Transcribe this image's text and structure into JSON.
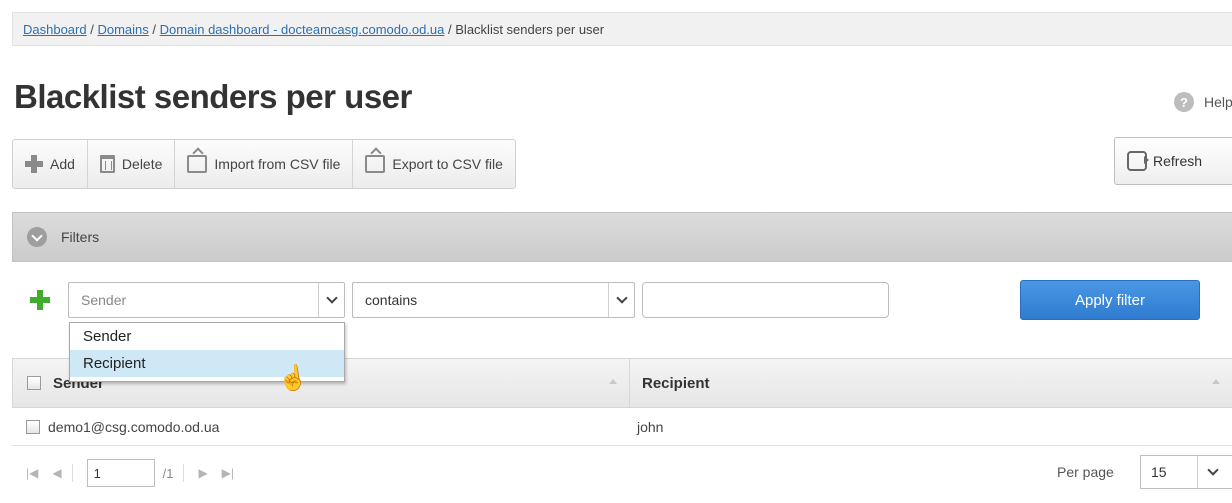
{
  "breadcrumb": {
    "items": [
      "Dashboard",
      "Domains",
      "Domain dashboard - docteamcasg.comodo.od.ua"
    ],
    "current": "Blacklist senders per user",
    "separator": "/"
  },
  "page": {
    "title": "Blacklist senders per user"
  },
  "help": {
    "label": "Help",
    "glyph": "?"
  },
  "toolbar": {
    "add_label": "Add",
    "delete_label": "Delete",
    "import_label": "Import from CSV file",
    "export_label": "Export to CSV file",
    "refresh_label": "Refresh"
  },
  "filters": {
    "title": "Filters",
    "field_placeholder": "Sender",
    "condition_value": "contains",
    "value_input": "",
    "apply_label": "Apply filter",
    "dropdown_options": [
      "Sender",
      "Recipient"
    ],
    "dropdown_highlighted": "Recipient"
  },
  "table": {
    "columns": [
      "Sender",
      "Recipient"
    ],
    "rows": [
      {
        "sender": "demo1@csg.comodo.od.ua",
        "recipient": "john"
      }
    ]
  },
  "pager": {
    "page": "1",
    "total": "/1",
    "per_page_label": "Per page",
    "per_page_value": "15"
  },
  "colors": {
    "link": "#2d6fb0",
    "apply_button": "#3a88dc",
    "add_filter_plus": "#3fae2a",
    "dropdown_highlight": "#cfe8f5"
  }
}
